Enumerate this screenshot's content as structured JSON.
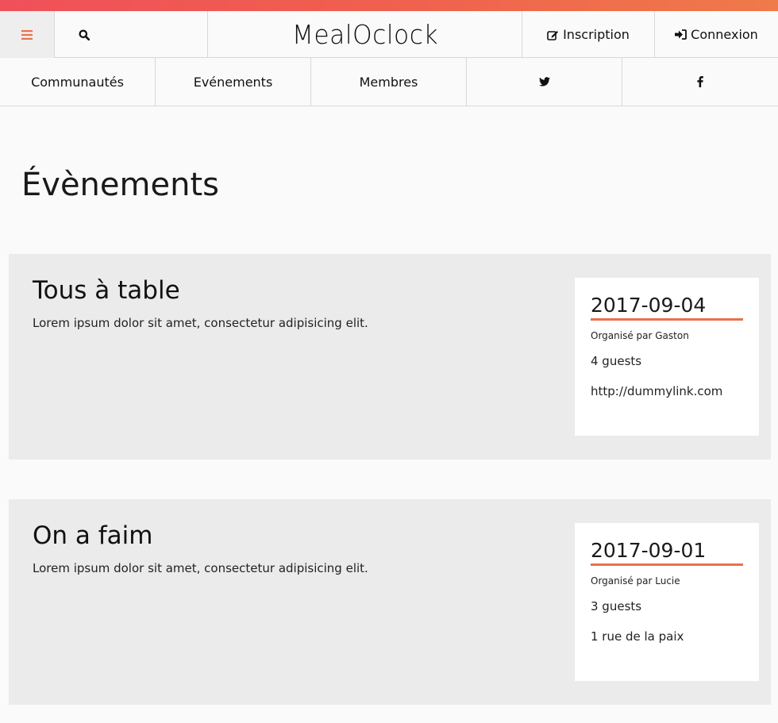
{
  "brand": {
    "logo_text": "MealOclock",
    "accent_color": "#e8714e"
  },
  "header": {
    "menu_icon": "hamburger-icon",
    "search_icon": "search-icon",
    "signup_label": "Inscription",
    "signup_icon": "edit-icon",
    "login_label": "Connexion",
    "login_icon": "sign-in-icon"
  },
  "nav": {
    "items": [
      {
        "label": "Communautés"
      },
      {
        "label": "Evénements"
      },
      {
        "label": "Membres"
      },
      {
        "icon": "twitter-icon"
      },
      {
        "icon": "facebook-icon"
      }
    ]
  },
  "page": {
    "title": "Évènements"
  },
  "events": [
    {
      "title": "Tous à table",
      "description": "Lorem ipsum dolor sit amet, consectetur adipisicing elit.",
      "date": "2017-09-04",
      "organizer": "Organisé par Gaston",
      "guests": "4 guests",
      "place": "http://dummylink.com"
    },
    {
      "title": "On a faim",
      "description": "Lorem ipsum dolor sit amet, consectetur adipisicing elit.",
      "date": "2017-09-01",
      "organizer": "Organisé par Lucie",
      "guests": "3 guests",
      "place": "1 rue de la paix"
    }
  ]
}
